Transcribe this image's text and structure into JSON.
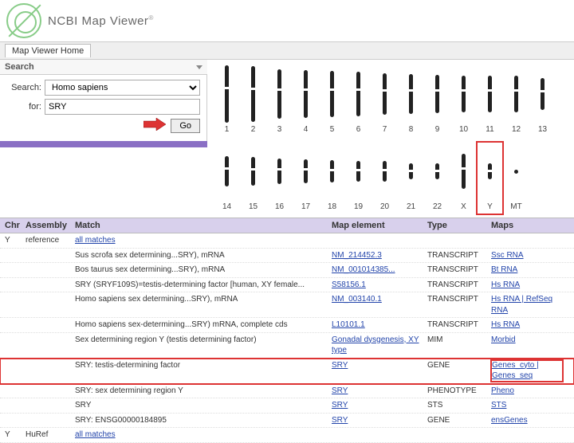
{
  "header": {
    "title": "NCBI Map Viewer"
  },
  "nav": {
    "tab": "Map Viewer Home"
  },
  "searchbar": {
    "label": "Search"
  },
  "form": {
    "search_label": "Search:",
    "organism": "Homo sapiens",
    "for_label": "for:",
    "query": "SRY",
    "go": "Go"
  },
  "chroms_row1": [
    {
      "n": "1",
      "h": 72
    },
    {
      "n": "2",
      "h": 70
    },
    {
      "n": "3",
      "h": 62
    },
    {
      "n": "4",
      "h": 60
    },
    {
      "n": "5",
      "h": 58
    },
    {
      "n": "6",
      "h": 56
    },
    {
      "n": "7",
      "h": 52
    },
    {
      "n": "8",
      "h": 50
    },
    {
      "n": "9",
      "h": 48
    },
    {
      "n": "10",
      "h": 46
    },
    {
      "n": "11",
      "h": 46
    },
    {
      "n": "12",
      "h": 46
    },
    {
      "n": "13",
      "h": 40
    }
  ],
  "chroms_row2": [
    {
      "n": "14",
      "h": 38
    },
    {
      "n": "15",
      "h": 36
    },
    {
      "n": "16",
      "h": 32
    },
    {
      "n": "17",
      "h": 30
    },
    {
      "n": "18",
      "h": 28
    },
    {
      "n": "19",
      "h": 26
    },
    {
      "n": "20",
      "h": 26
    },
    {
      "n": "21",
      "h": 20
    },
    {
      "n": "22",
      "h": 20
    },
    {
      "n": "X",
      "h": 44
    },
    {
      "n": "Y",
      "h": 20,
      "hl": true
    },
    {
      "n": "MT",
      "h": 0,
      "dot": true
    }
  ],
  "columns": {
    "chr": "Chr",
    "asm": "Assembly",
    "match": "Match",
    "map": "Map element",
    "type": "Type",
    "maps": "Maps"
  },
  "rows": [
    {
      "chr": "Y",
      "asm": "reference",
      "match_link": "all matches"
    },
    {
      "match": "Sus scrofa sex determining...SRY), mRNA",
      "map": "NM_214452.3",
      "map_link": true,
      "type": "TRANSCRIPT",
      "maps": "Ssc RNA",
      "maps_link": true
    },
    {
      "match": "Bos taurus sex determining...SRY), mRNA",
      "map": "NM_001014385...",
      "map_link": true,
      "type": "TRANSCRIPT",
      "maps": "Bt RNA",
      "maps_link": true
    },
    {
      "match": "SRY (SRYF109S)=testis-determining factor [human, XY female...",
      "map": "S58156.1",
      "map_link": true,
      "type": "TRANSCRIPT",
      "maps": "Hs RNA",
      "maps_link": true
    },
    {
      "match": "Homo sapiens sex determining...SRY), mRNA",
      "map": "NM_003140.1",
      "map_link": true,
      "type": "TRANSCRIPT",
      "maps": "Hs RNA | RefSeq RNA",
      "maps_link": true
    },
    {
      "match": "Homo sapiens sex-determining...SRY) mRNA, complete cds",
      "map": "L10101.1",
      "map_link": true,
      "type": "TRANSCRIPT",
      "maps": "Hs RNA",
      "maps_link": true
    },
    {
      "match": "Sex determining region Y (testis determining factor)",
      "map": "Gonadal dysgenesis, XY type",
      "map_link": true,
      "type": "MIM",
      "maps": "Morbid",
      "maps_link": true
    },
    {
      "match": "SRY: testis-determining factor",
      "map": "SRY",
      "map_link": true,
      "type": "GENE",
      "maps": "Genes_cyto | Genes_seq",
      "maps_link": true,
      "hl": true,
      "maps_hl": true
    },
    {
      "match": "SRY: sex determining region Y",
      "map": "SRY",
      "map_link": true,
      "type": "PHENOTYPE",
      "maps": "Pheno",
      "maps_link": true
    },
    {
      "match": "SRY",
      "map": "SRY",
      "map_link": true,
      "type": "STS",
      "maps": "STS",
      "maps_link": true
    },
    {
      "match": "SRY: ENSG00000184895",
      "map": "SRY",
      "map_link": true,
      "type": "GENE",
      "maps": "ensGenes",
      "maps_link": true
    },
    {
      "chr": "Y",
      "asm": "HuRef",
      "match_link": "all matches"
    }
  ]
}
